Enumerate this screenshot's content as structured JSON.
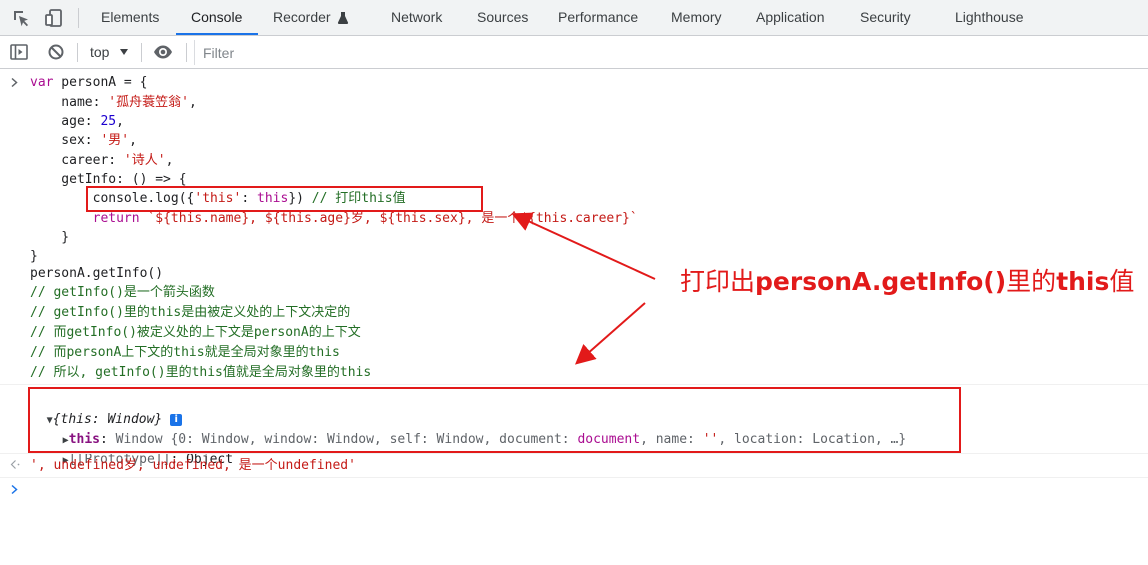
{
  "tabs": [
    {
      "label": "Elements",
      "active": false
    },
    {
      "label": "Console",
      "active": true
    },
    {
      "label": "Recorder",
      "active": false
    },
    {
      "label": "Network",
      "active": false
    },
    {
      "label": "Sources",
      "active": false
    },
    {
      "label": "Performance",
      "active": false
    },
    {
      "label": "Memory",
      "active": false
    },
    {
      "label": "Application",
      "active": false
    },
    {
      "label": "Security",
      "active": false
    },
    {
      "label": "Lighthouse",
      "active": false
    }
  ],
  "toolbar": {
    "context_label": "top",
    "filter_placeholder": "Filter"
  },
  "code": {
    "l1_kw": "var",
    "l1_rest": " personA = {",
    "name_key": "    name: ",
    "name_val": "'孤舟蓑笠翁'",
    "age_key": "    age: ",
    "age_val": "25",
    "sex_key": "    sex: ",
    "sex_val": "'男'",
    "career_key": "    career: ",
    "career_val": "'诗人'",
    "getinfo": "    getInfo: () => {",
    "log_pre": "        console.log({",
    "log_str": "'this'",
    "log_mid": ": ",
    "log_this": "this",
    "log_post": "}) ",
    "log_comment": "// 打印this值",
    "ret_indent": "        ",
    "ret_kw": "return",
    "ret_tpl": " `${this.name}, ${this.age}岁, ${this.sex}, 是一个${this.career}`",
    "close_inner": "    }",
    "close_outer": "}",
    "call": "personA.getInfo()",
    "c1": "// getInfo()是一个箭头函数",
    "c2": "// getInfo()里的this是由被定义处的上下文决定的",
    "c3": "// 而getInfo()被定义处的上下文是personA的上下文",
    "c4": "// 而personA上下文的this就是全局对象里的this",
    "c5": "// 所以, getInfo()里的this值就是全局对象里的this"
  },
  "log_output": {
    "summary": "{this: Window}",
    "info_badge": "i",
    "prop_name": "this",
    "prop_sep": ": ",
    "prop_val_start": "Window {0: Window, window: Window, self: Window, ",
    "document_key": "document",
    "document_sep": ": ",
    "document_val": "document",
    "after_doc": ", name: ",
    "name_val": "''",
    "after_name": ", location: Location, …}",
    "proto_label": "[[Prototype]]",
    "proto_val": ": Object"
  },
  "return_value": "', undefined岁, undefined, 是一个undefined'",
  "annotation": {
    "part1": "打印出",
    "part2": "personA.getInfo()",
    "part3": "里的",
    "part4": "this",
    "part5": "值"
  },
  "colors": {
    "annotation_red": "#e21a1a",
    "active_tab_blue": "#1a73e8",
    "string_red": "#c41a16",
    "keyword_purple": "#aa0d91",
    "comment_green": "#236e25",
    "number_blue": "#1c00cf"
  },
  "icons": [
    "inspect-element-icon",
    "device-toolbar-icon",
    "recorder-flask-icon",
    "sidebar-toggle-icon",
    "clear-console-icon",
    "dropdown-arrow-icon",
    "live-expression-eye-icon",
    "info-icon",
    "expand-triangle-icon",
    "input-prompt-icon",
    "return-arrow-icon"
  ]
}
